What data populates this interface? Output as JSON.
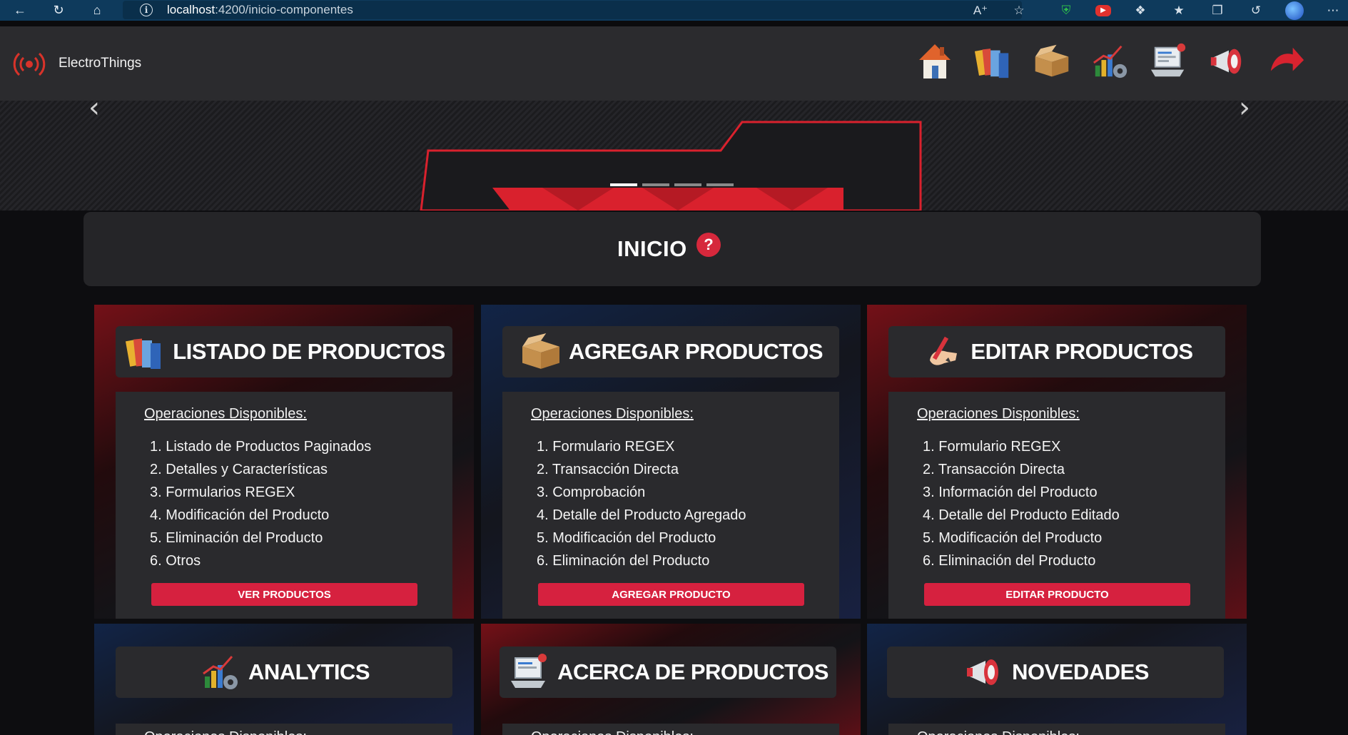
{
  "browser": {
    "url_host": "localhost",
    "url_path": ":4200/inicio-componentes"
  },
  "header": {
    "brand": "ElectroThings",
    "nav_icons": [
      "house-icon",
      "books-icon",
      "box-icon",
      "analytics-icon",
      "laptop-icon",
      "megaphone-icon",
      "logout-arrow-icon"
    ]
  },
  "carousel": {
    "slides": 4,
    "active": 0
  },
  "page": {
    "title": "INICIO",
    "help": "?"
  },
  "cards": [
    {
      "title": "LISTADO DE PRODUCTOS",
      "icon": "books-icon",
      "ops_title": "Operaciones Disponibles:",
      "ops": [
        "1. Listado de Productos Paginados",
        "2. Detalles y Características",
        "3. Formularios REGEX",
        "4. Modificación del Producto",
        "5. Eliminación del Producto",
        "6. Otros"
      ],
      "button": "VER PRODUCTOS"
    },
    {
      "title": "AGREGAR PRODUCTOS",
      "icon": "box-icon",
      "ops_title": "Operaciones Disponibles:",
      "ops": [
        "1. Formulario REGEX",
        "2. Transacción Directa",
        "3. Comprobación",
        "4. Detalle del Producto Agregado",
        "5. Modificación del Producto",
        "6. Eliminación del Producto"
      ],
      "button": "AGREGAR PRODUCTO"
    },
    {
      "title": "EDITAR PRODUCTOS",
      "icon": "edit-hand-icon",
      "ops_title": "Operaciones Disponibles:",
      "ops": [
        "1. Formulario REGEX",
        "2. Transacción Directa",
        "3. Información del Producto",
        "4. Detalle del Producto Editado",
        "5. Modificación del Producto",
        "6. Eliminación del Producto"
      ],
      "button": "EDITAR PRODUCTO"
    },
    {
      "title": "ANALYTICS",
      "icon": "analytics-icon",
      "ops_title": "Operaciones Disponibles:"
    },
    {
      "title": "ACERCA DE PRODUCTOS",
      "icon": "laptop-icon",
      "ops_title": "Operaciones Disponibles:"
    },
    {
      "title": "NOVEDADES",
      "icon": "megaphone-icon",
      "ops_title": "Operaciones Disponibles:"
    }
  ]
}
